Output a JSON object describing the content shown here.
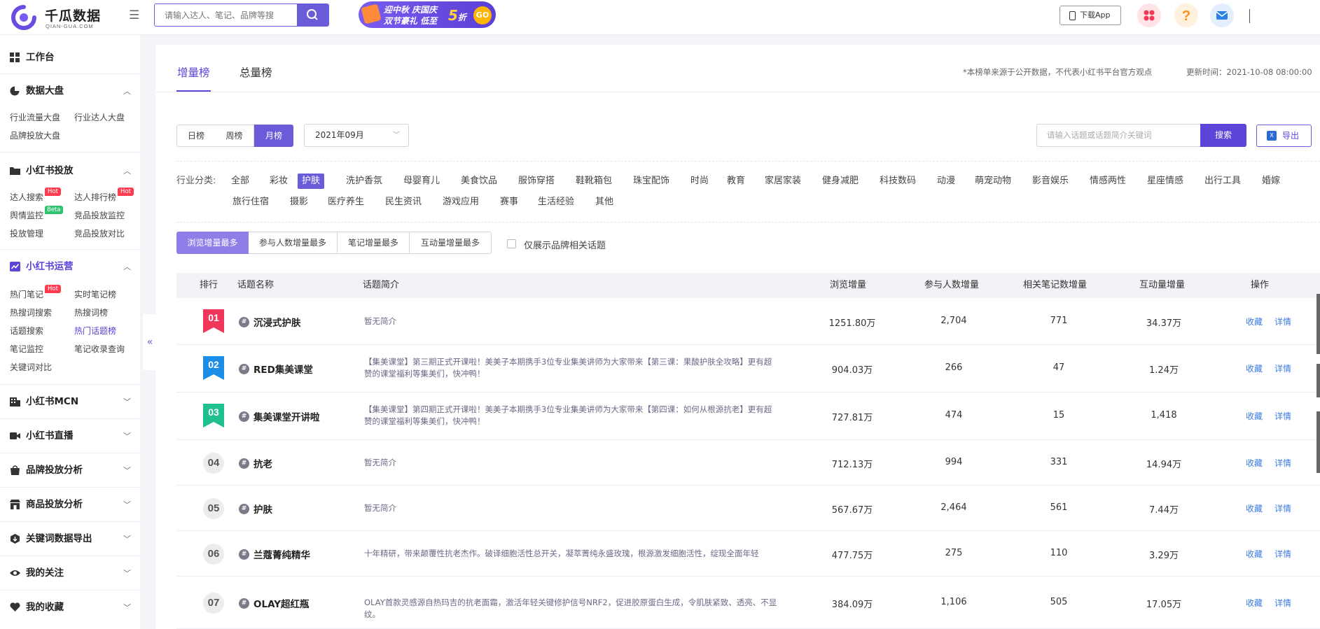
{
  "header": {
    "logo_name": "千瓜数据",
    "logo_sub": "QIAN-GUA.COM",
    "search_placeholder": "请输入达人、笔记、品牌等搜",
    "banner_line1": "迎中秋 庆国庆",
    "banner_line2": "双节豪礼 低至",
    "banner_discount": "5",
    "banner_zhe": "折",
    "banner_go": "GO",
    "download_app": "下载App"
  },
  "sidebar": {
    "workbench": "工作台",
    "sections": [
      {
        "title": "数据大盘",
        "items": [
          "行业流量大盘",
          "行业达人大盘",
          "品牌投放大盘"
        ]
      },
      {
        "title": "小红书投放",
        "items": [
          "达人搜索",
          "达人排行榜",
          "舆情监控",
          "竞品投放监控",
          "投放管理",
          "竞品投放对比"
        ]
      },
      {
        "title": "小红书运营",
        "items": [
          "热门笔记",
          "实时笔记榜",
          "热搜词搜索",
          "热搜词榜",
          "话题搜索",
          "热门话题榜",
          "笔记监控",
          "笔记收录查询",
          "关键词对比"
        ]
      },
      {
        "title": "小红书MCN"
      },
      {
        "title": "小红书直播"
      },
      {
        "title": "品牌投放分析"
      },
      {
        "title": "商品投放分析"
      },
      {
        "title": "关键词数据导出"
      },
      {
        "title": "我的关注"
      },
      {
        "title": "我的收藏"
      }
    ],
    "hot_badge": "Hot",
    "beta_badge": "Beta",
    "collapse_icon": "«"
  },
  "main": {
    "tabs": [
      "增量榜",
      "总量榜"
    ],
    "disclaimer": "*本榜单来源于公开数据，不代表小红书平台官方观点",
    "updated": "更新时间：2021-10-08 08:00:00",
    "period": [
      "日榜",
      "周榜",
      "月榜"
    ],
    "date_value": "2021年09月",
    "topic_search_placeholder": "请输入话题或话题简介关键词",
    "search_btn": "搜索",
    "export_btn": "导出",
    "industry_label": "行业分类:",
    "industries": [
      "全部",
      "彩妆",
      "护肤",
      "洗护香氛",
      "母婴育儿",
      "美食饮品",
      "服饰穿搭",
      "鞋靴箱包",
      "珠宝配饰",
      "时尚",
      "教育",
      "家居家装",
      "健身减肥",
      "科技数码",
      "动漫",
      "萌宠动物",
      "影音娱乐",
      "情感两性",
      "星座情感",
      "出行工具",
      "婚嫁",
      "旅行住宿",
      "摄影",
      "医疗养生",
      "民生资讯",
      "游戏应用",
      "赛事",
      "生活经验",
      "其他"
    ],
    "sorts": [
      "浏览增量最多",
      "参与人数增量最多",
      "笔记增量最多",
      "互动量增量最多"
    ],
    "brand_only_label": "仅展示品牌相关话题",
    "columns": [
      "排行",
      "话题名称",
      "话题简介",
      "浏览增量",
      "参与人数增量",
      "相关笔记数增量",
      "互动量增量",
      "操作"
    ],
    "collect": "收藏",
    "detail": "详情",
    "rows": [
      {
        "rank": "01",
        "name": "沉浸式护肤",
        "desc": "暂无简介",
        "views": "1251.80万",
        "people": "2,704",
        "notes": "771",
        "interact": "34.37万"
      },
      {
        "rank": "02",
        "name": "RED集美课堂",
        "desc": "【集美课堂】第三期正式开课啦！美美子本期携手3位专业集美讲师为大家带来【第三课：果酸护肤全攻略】更有超赞的课堂福利等集美们，快冲鸭！",
        "views": "904.03万",
        "people": "266",
        "notes": "47",
        "interact": "1.24万"
      },
      {
        "rank": "03",
        "name": "集美课堂开讲啦",
        "desc": "【集美课堂】第四期正式开课啦！美美子本期携手3位专业集美讲师为大家带来【第四课：如何从根源抗老】更有超赞的课堂福利等集美们，快冲鸭！",
        "views": "727.81万",
        "people": "474",
        "notes": "15",
        "interact": "1,418"
      },
      {
        "rank": "04",
        "name": "抗老",
        "desc": "暂无简介",
        "views": "712.13万",
        "people": "994",
        "notes": "331",
        "interact": "14.94万"
      },
      {
        "rank": "05",
        "name": "护肤",
        "desc": "暂无简介",
        "views": "567.67万",
        "people": "2,464",
        "notes": "561",
        "interact": "7.44万"
      },
      {
        "rank": "06",
        "name": "兰蔻菁纯精华",
        "desc": "十年精研，带来颠覆性抗老杰作。破译细胞活性总开关，凝萃菁纯永盛玫瑰，根源激发细胞活性，绽现全面年轻",
        "views": "477.75万",
        "people": "275",
        "notes": "110",
        "interact": "3.29万"
      },
      {
        "rank": "07",
        "name": "OLAY超红瓶",
        "desc": "OLAY首款灵感源自热玛吉的抗老面霜，激活年轻关键修护信号NRF2，促进胶原蛋白生成，令肌肤紧致、透亮、不显纹。",
        "views": "384.09万",
        "people": "1,106",
        "notes": "505",
        "interact": "17.05万"
      }
    ]
  },
  "colors": {
    "accent": "#5b44d8",
    "rank1": "#f0365a",
    "rank2": "#1d8ee8",
    "rank3": "#1fbf8f",
    "link": "#3d7be0"
  }
}
